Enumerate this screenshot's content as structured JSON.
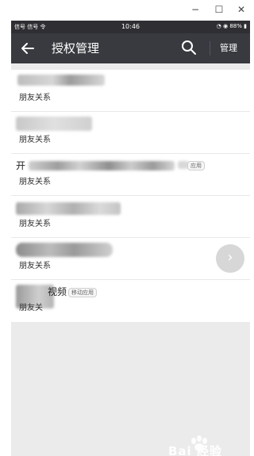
{
  "window": {
    "minimize_label": "−",
    "maximize_label": "☐",
    "close_label": "✕"
  },
  "statusbar": {
    "signal_text": "信号 信号 令",
    "time": "10:46",
    "battery_text": "88%"
  },
  "appbar": {
    "title": "授权管理",
    "manage_label": "管理",
    "back_icon": "arrow-left-icon",
    "search_icon": "search-icon"
  },
  "list": {
    "items": [
      {
        "subtitle": "朋友关系"
      },
      {
        "subtitle": "朋友关系"
      },
      {
        "title_fragment": "开",
        "tag": "应用",
        "subtitle": "朋友关系"
      },
      {
        "subtitle": "朋友关系"
      },
      {
        "subtitle": "朋友关系"
      },
      {
        "title_fragment": "视频",
        "tag": "移动应用",
        "subtitle": "朋友关"
      }
    ]
  },
  "fab": {
    "icon": "chevron-right-icon"
  },
  "watermark": {
    "text": "Bai 经验",
    "icon": "paw-icon"
  },
  "colors": {
    "statusbar": "#2f2f33",
    "appbar": "#393a3f",
    "background": "#ebebeb"
  }
}
